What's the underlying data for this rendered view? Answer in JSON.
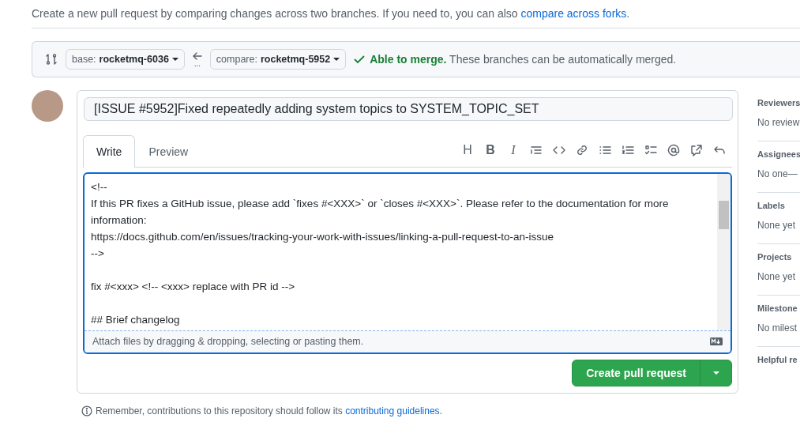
{
  "intro": {
    "text": "Create a new pull request by comparing changes across two branches. If you need to, you can also ",
    "link": "compare across forks",
    "tail": "."
  },
  "compare_bar": {
    "base": {
      "prefix": "base:",
      "branch": "rocketmq-6036"
    },
    "compare": {
      "prefix": "compare:",
      "branch": "rocketmq-5952"
    },
    "dots": "...",
    "merge_status": "**Able to merge.** These branches can be automatically merged."
  },
  "title_field": {
    "value": "[ISSUE #5952]Fixed repeatedly adding system topics to SYSTEM_TOPIC_SET"
  },
  "tabs": [
    {
      "label": "Write",
      "selected": true
    },
    {
      "label": "Preview",
      "selected": false
    }
  ],
  "toolbar_glyphs": [
    "H",
    "B",
    "I"
  ],
  "body": [
    [
      "<!--",
      "If this PR fixes a GitHub issue, please add `fixes #<XXX>` or `closes #<XXX>`. Please refer to the documentation for more",
      "information:",
      "https://docs.github.com/en/issues/tracking-your-work-with-issues/linking-a-pull-request-to-an-issue",
      "-->"
    ],
    [
      "fix #<xxx> <!-- <xxx> replace with PR id -->"
    ],
    [
      "## Brief changelog"
    ]
  ],
  "attach_hint": "Attach files by dragging & dropping, selecting or pasting them.",
  "submit": {
    "label": "Create pull request"
  },
  "footer": {
    "text": "Remember, contributions to this repository should follow its ",
    "link": "contributing guidelines",
    "tail": "."
  },
  "sidebar": [
    {
      "heading": "Reviewers",
      "value": "No review"
    },
    {
      "heading": "Assignees",
      "value": "No one—"
    },
    {
      "heading": "Labels",
      "value": "None yet"
    },
    {
      "heading": "Projects",
      "value": "None yet"
    },
    {
      "heading": "Milestone",
      "value": "No milest"
    },
    {
      "heading": "Helpful re"
    }
  ]
}
